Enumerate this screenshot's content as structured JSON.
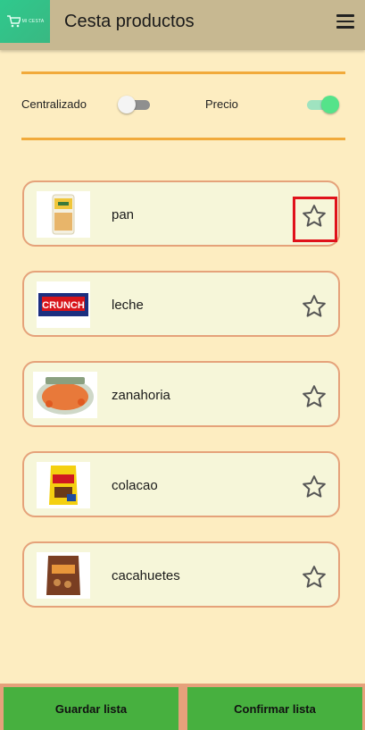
{
  "header": {
    "title": "Cesta productos",
    "logo_text": "MI CESTA",
    "menu_icon": "hamburger-menu-icon"
  },
  "filters": {
    "centralizado_label": "Centralizado",
    "centralizado_on": false,
    "precio_label": "Precio",
    "precio_on": true
  },
  "products": [
    {
      "name": "pan",
      "favorite": false,
      "image": "bread-package"
    },
    {
      "name": "leche",
      "favorite": false,
      "image": "crunch-chocolate-bar"
    },
    {
      "name": "zanahoria",
      "favorite": false,
      "image": "soup-bowl"
    },
    {
      "name": "colacao",
      "favorite": false,
      "image": "cocoa-pack"
    },
    {
      "name": "cacahuetes",
      "favorite": false,
      "image": "peanut-bag"
    }
  ],
  "footer": {
    "save_label": "Guardar lista",
    "confirm_label": "Confirmar lista"
  },
  "colors": {
    "accent": "#f1aa3b",
    "card_border": "#e5a27a",
    "button": "#47b03f",
    "highlight": "#e0121b"
  }
}
